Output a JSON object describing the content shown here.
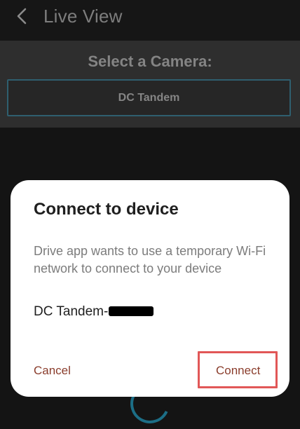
{
  "app_bar": {
    "back_icon": "chevron-left-icon",
    "title": "Live View"
  },
  "camera_panel": {
    "heading": "Select a Camera:",
    "options": [
      {
        "label": "DC Tandem",
        "selected": true
      }
    ]
  },
  "dialog": {
    "title": "Connect to device",
    "message": "Drive app wants to use a temporary Wi-Fi network to connect to your device",
    "device_name_prefix": "DC Tandem-",
    "cancel_label": "Cancel",
    "connect_label": "Connect"
  },
  "colors": {
    "background": "#141414",
    "panel": "#2e2e2e",
    "selection_border": "#2f5f6f",
    "dialog_background": "#ffffff",
    "action_text": "#8a3d2c",
    "highlight": "#e15757"
  }
}
